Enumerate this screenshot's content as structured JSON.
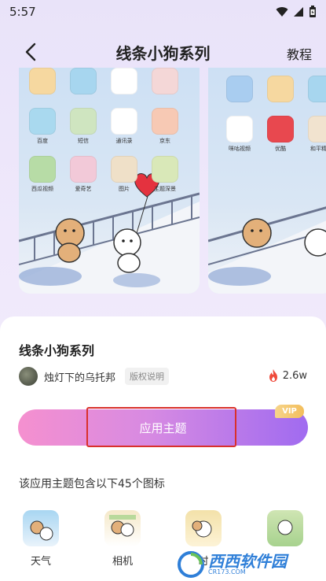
{
  "status_bar": {
    "time": "5:57"
  },
  "header": {
    "title": "线条小狗系列",
    "tutorial_label": "教程"
  },
  "preview": {
    "main_labels_row1": [
      "百度",
      "短信",
      "通讯录",
      "京东"
    ],
    "main_labels_row2": [
      "西瓜视频",
      "爱奇艺",
      "图片",
      "主题深景"
    ],
    "next_labels": [
      "咪咕视频",
      "优酷",
      "和平精英"
    ]
  },
  "theme": {
    "name": "线条小狗系列",
    "author": "烛灯下的乌托邦",
    "copyright_label": "版权说明",
    "hot_count": "2.6w",
    "apply_label": "应用主题",
    "vip_label": "VIP",
    "icons_caption": "该应用主题包含以下45个图标"
  },
  "icons": [
    {
      "label": "天气"
    },
    {
      "label": "相机"
    },
    {
      "label": "时"
    }
  ],
  "watermark": {
    "text": "西西软件园",
    "sub": "CR173.COM"
  }
}
